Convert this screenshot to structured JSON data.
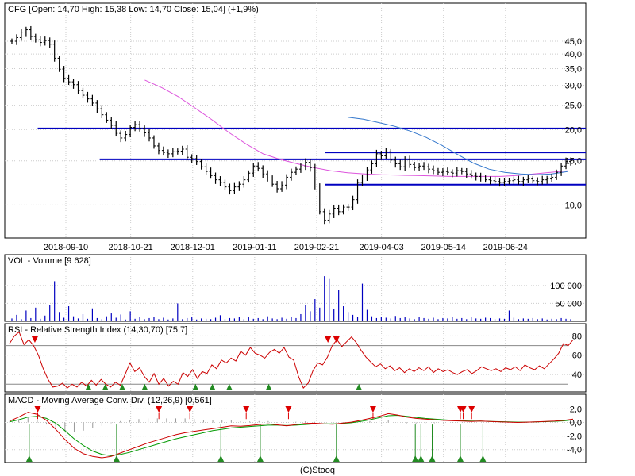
{
  "chart_data": {
    "type": "stock",
    "x_tick_labels": [
      "2018-09-10",
      "2018-10-21",
      "2018-12-01",
      "2019-01-11",
      "2019-02-21",
      "2019-04-03",
      "2019-05-14",
      "2019-06-24"
    ],
    "footer": "(C)Stooq",
    "colors": {
      "price": "#000000",
      "volume": "#0000c0",
      "sr": "#0000c0",
      "sma_long": "#dd55dd",
      "sma_mid": "#3377cc",
      "rsi": "#cc0000",
      "macd": "#cc0000",
      "signal": "#009900",
      "buy": "#228b22",
      "sell": "#dd0000",
      "grid": "#cccccc"
    },
    "price_panel": {
      "title": "CFG [Open: 14,70  High: 15,38  Low: 14,70  Close: 15,04] (+1,9%)",
      "scale": "log",
      "y_range": [
        7.6,
        56
      ],
      "y_ticks": [
        10,
        15,
        20,
        25,
        30,
        35,
        40,
        45
      ],
      "y_tick_labels": [
        "10,0",
        "15,0",
        "20,0",
        "25,0",
        "30,0",
        "35,0",
        "40,0",
        "45,0"
      ],
      "closes": [
        45,
        46.5,
        48.6,
        50,
        47,
        45.6,
        44.5,
        45.3,
        43.8,
        38.5,
        34.8,
        32,
        31,
        30.2,
        28.6,
        27.4,
        26.5,
        25.5,
        24.2,
        22.9,
        21.8,
        20.8,
        19.3,
        18.5,
        19.1,
        20.4,
        20.9,
        20.2,
        19.4,
        18.5,
        17.2,
        16.5,
        16.2,
        16.0,
        16.3,
        16.4,
        16.7,
        15.5,
        15.3,
        14.9,
        14.2,
        13.6,
        13.1,
        12.6,
        12.3,
        11.8,
        11.4,
        11.8,
        12.1,
        12.6,
        13.4,
        14.3,
        14.0,
        13.3,
        12.8,
        12.1,
        11.6,
        12.0,
        12.9,
        13.5,
        13.9,
        14.2,
        14.8,
        14.1,
        11.9,
        9.4,
        8.7,
        9.2,
        9.7,
        9.4,
        9.8,
        9.8,
        10.5,
        12.3,
        12.8,
        13.8,
        14.6,
        16.0,
        15.7,
        16.3,
        15.1,
        14.6,
        14.2,
        15.2,
        14.5,
        14.1,
        14.3,
        14.2,
        13.9,
        13.7,
        13.5,
        13.6,
        13.5,
        13.4,
        13.7,
        13.6,
        13.3,
        13.1,
        13.0,
        12.8,
        12.6,
        12.5,
        12.4,
        12.3,
        12.4,
        12.5,
        12.6,
        12.4,
        12.6,
        12.7,
        12.5,
        12.4,
        12.6,
        12.7,
        12.9,
        13.5,
        14.3,
        14.9,
        15.04
      ],
      "sma_long": {
        "start": 0.24,
        "values": [
          31.5,
          29.4,
          27.0,
          24.3,
          21.8,
          19.4,
          17.5,
          16.0,
          15.2,
          14.6,
          14.1,
          13.7,
          13.45,
          13.3,
          13.2,
          13.15,
          13.1,
          13.05,
          13.0,
          13.0,
          13.0,
          13.0,
          13.1,
          13.3,
          13.5,
          13.7
        ]
      },
      "sma_mid": {
        "start": 0.6,
        "values": [
          22.4,
          22.0,
          21.3,
          20.6,
          19.7,
          18.6,
          17.3,
          15.9,
          14.7,
          13.9,
          13.5,
          13.3,
          13.2,
          13.3,
          13.6
        ]
      },
      "support_resistance": [
        {
          "level": 20.2,
          "x_from": 0.05,
          "x_to": 1.0
        },
        {
          "level": 15.2,
          "x_from": 0.16,
          "x_to": 1.0
        },
        {
          "level": 16.2,
          "x_from": 0.56,
          "x_to": 1.0
        },
        {
          "level": 12.05,
          "x_from": 0.56,
          "x_to": 1.0
        }
      ]
    },
    "volume_panel": {
      "title": "VOL - Volume [9 628]",
      "y_range": [
        0,
        155000
      ],
      "y_ticks": [
        50000,
        100000
      ],
      "y_tick_labels": [
        "50 000",
        "100 000"
      ],
      "values": [
        8000,
        18000,
        6000,
        30000,
        9000,
        38000,
        7000,
        16000,
        45000,
        112000,
        26000,
        10000,
        42000,
        14000,
        8000,
        20000,
        7000,
        36000,
        9000,
        6000,
        14000,
        22000,
        10000,
        19000,
        5000,
        28000,
        7000,
        11000,
        6000,
        9000,
        12000,
        6000,
        10000,
        5000,
        8000,
        50000,
        6000,
        9000,
        11000,
        5000,
        8000,
        7000,
        6000,
        10000,
        17000,
        6000,
        9000,
        8000,
        12000,
        6000,
        11000,
        7000,
        9000,
        6000,
        14000,
        8000,
        6000,
        10000,
        7000,
        12000,
        9000,
        20000,
        46000,
        28000,
        62000,
        38000,
        126000,
        118000,
        35000,
        88000,
        42000,
        26000,
        18000,
        12000,
        105000,
        32000,
        14000,
        9000,
        12000,
        10000,
        8000,
        15000,
        9000,
        11000,
        8000,
        6000,
        12000,
        9000,
        7000,
        10000,
        6000,
        9000,
        8000,
        12000,
        7000,
        9000,
        6000,
        11000,
        8000,
        7000,
        10000,
        9000,
        6000,
        8000,
        7000,
        30000,
        10000,
        6000,
        8000,
        7000,
        9000,
        6000,
        8000,
        5000,
        7000,
        6000,
        9000,
        7000,
        6000
      ]
    },
    "rsi_panel": {
      "title": "RSI - Relative Strength Index (14,30,70) [75,7]",
      "y_range": [
        22,
        91
      ],
      "y_ticks": [
        40,
        60,
        80
      ],
      "y_tick_labels": [
        "40",
        "60",
        "80"
      ],
      "levels": [
        30,
        70
      ],
      "values": [
        72,
        80,
        84,
        71,
        76,
        70,
        60,
        46,
        35,
        27,
        28,
        31,
        26,
        30,
        27,
        32,
        28,
        34,
        29,
        35,
        30,
        27,
        32,
        29,
        40,
        52,
        43,
        47,
        38,
        32,
        41,
        30,
        36,
        28,
        33,
        30,
        42,
        38,
        45,
        36,
        43,
        41,
        50,
        46,
        55,
        52,
        57,
        54,
        64,
        60,
        68,
        62,
        60,
        57,
        63,
        66,
        62,
        68,
        58,
        55,
        38,
        26,
        31,
        44,
        52,
        50,
        58,
        70,
        76,
        69,
        74,
        79,
        73,
        65,
        58,
        53,
        48,
        51,
        46,
        49,
        44,
        47,
        42,
        46,
        43,
        47,
        44,
        48,
        42,
        46,
        43,
        45,
        42,
        40,
        43,
        45,
        41,
        44,
        48,
        46,
        44,
        46,
        43,
        47,
        45,
        48,
        44,
        50,
        47,
        45,
        49,
        46,
        51,
        56,
        62,
        72,
        70,
        76
      ],
      "buy_signals": [
        0.14,
        0.17,
        0.2,
        0.24,
        0.33,
        0.36,
        0.39,
        0.46,
        0.62
      ],
      "sell_signals": [
        0.045,
        0.565,
        0.58
      ]
    },
    "macd_panel": {
      "title": "MACD - Moving Average Conv. Div. (12,26,9) [0,561]",
      "y_range": [
        -5.9,
        3.8
      ],
      "y_ticks": [
        -4,
        -2,
        0,
        2
      ],
      "y_tick_labels": [
        "-4,0",
        "-2,0",
        "0,0",
        "2,0"
      ],
      "macd": [
        0.2,
        0.8,
        1.5,
        1.2,
        0.3,
        -1.0,
        -2.5,
        -3.8,
        -4.6,
        -5.0,
        -5.2,
        -5.0,
        -4.5,
        -4.0,
        -3.5,
        -3.0,
        -2.6,
        -2.2,
        -1.8,
        -1.5,
        -1.3,
        -1.1,
        -0.9,
        -0.7,
        -0.5,
        -0.55,
        -0.45,
        -0.3,
        -0.2,
        -0.35,
        -0.5,
        -0.3,
        -0.15,
        -0.1,
        -0.2,
        -0.25,
        -0.1,
        0.05,
        0.3,
        0.6,
        0.9,
        1.3,
        1.1,
        0.8,
        0.6,
        0.5,
        0.4,
        0.3,
        0.25,
        0.2,
        0.15,
        0.2,
        0.15,
        0.1,
        0.05,
        0.0,
        0.05,
        0.1,
        0.15,
        0.2,
        0.3,
        0.5
      ],
      "signal": [
        0.1,
        0.4,
        0.8,
        0.9,
        0.6,
        -0.1,
        -1.2,
        -2.4,
        -3.4,
        -4.2,
        -4.7,
        -4.9,
        -4.7,
        -4.4,
        -4.0,
        -3.6,
        -3.2,
        -2.8,
        -2.4,
        -2.1,
        -1.8,
        -1.5,
        -1.2,
        -1.0,
        -0.8,
        -0.7,
        -0.6,
        -0.5,
        -0.4,
        -0.4,
        -0.45,
        -0.4,
        -0.3,
        -0.2,
        -0.2,
        -0.2,
        -0.15,
        -0.05,
        0.15,
        0.4,
        0.7,
        1.0,
        1.05,
        0.9,
        0.75,
        0.6,
        0.5,
        0.4,
        0.3,
        0.25,
        0.2,
        0.2,
        0.15,
        0.12,
        0.08,
        0.05,
        0.05,
        0.08,
        0.12,
        0.16,
        0.24,
        0.4
      ],
      "buy_signals": [
        0.035,
        0.19,
        0.375,
        0.445,
        0.58,
        0.72,
        0.73,
        0.75,
        0.8,
        0.84
      ],
      "sell_signals": [
        0.05,
        0.265,
        0.32,
        0.42,
        0.495,
        0.645,
        0.8,
        0.805,
        0.82
      ]
    }
  }
}
